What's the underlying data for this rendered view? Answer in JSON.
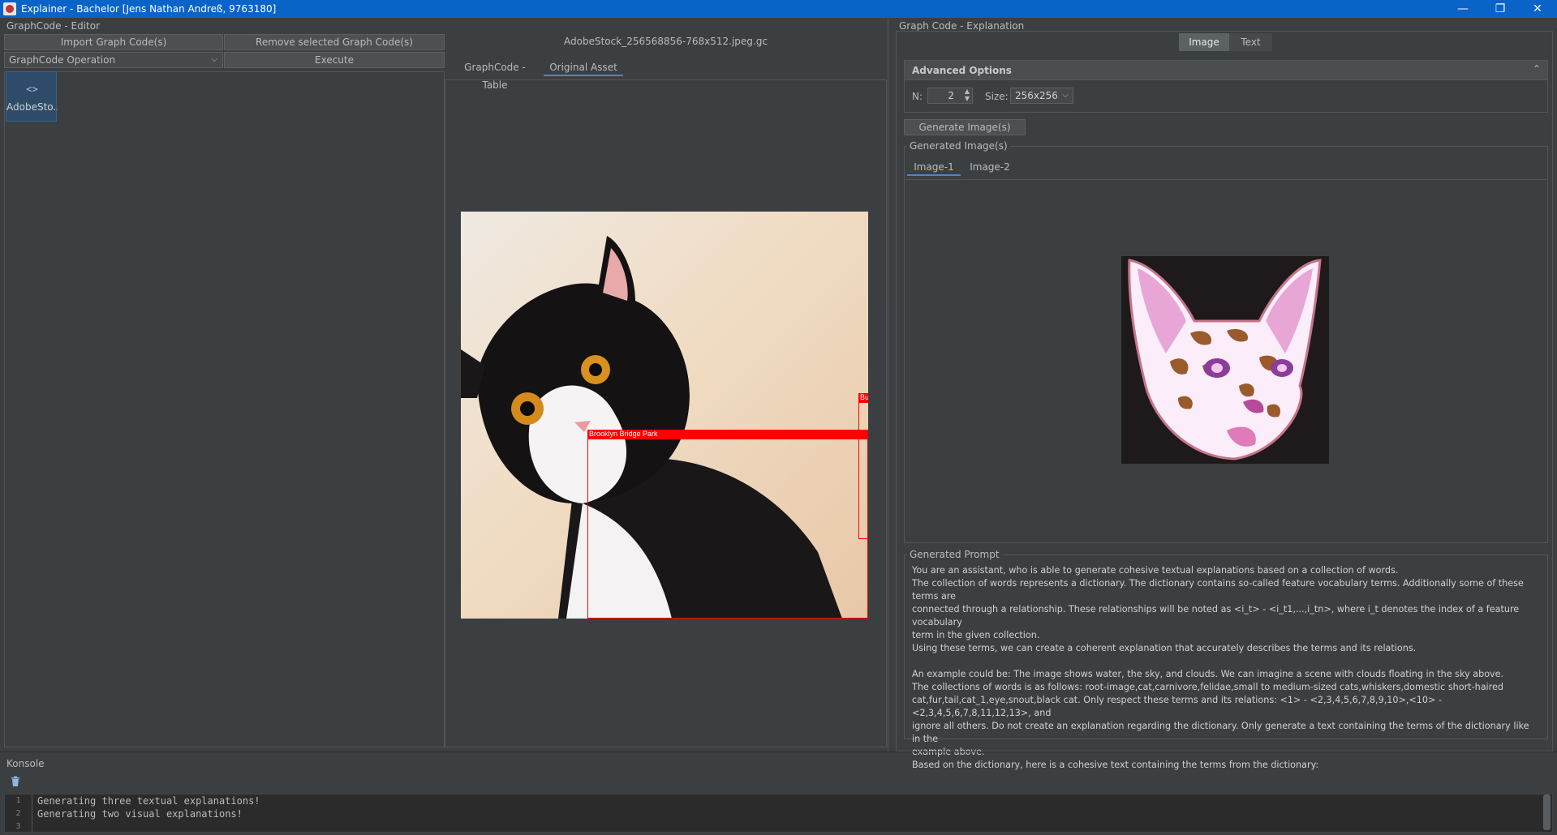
{
  "window": {
    "title": "Explainer - Bachelor [Jens Nathan Andreß, 9763180]",
    "minimize": "—",
    "restore": "❐",
    "close": "✕"
  },
  "editor": {
    "panel_title": "GraphCode - Editor",
    "import_label": "Import Graph Code(s)",
    "remove_label": "Remove selected Graph Code(s)",
    "operation_value": "GraphCode Operation",
    "execute_label": "Execute",
    "tile": {
      "icon": "code-icon",
      "label": "AdobeSto..."
    }
  },
  "viewer": {
    "file_name": "AdobeStock_256568856-768x512.jpeg.gc",
    "tabs": [
      "GraphCode - Table",
      "Original Asset"
    ],
    "active_tab": "Original Asset",
    "bbox_labels": [
      "Brooklyn Bridge Park",
      "Bu"
    ]
  },
  "explanation": {
    "panel_title": "Graph Code - Explanation",
    "mode_tabs": [
      "Image",
      "Text"
    ],
    "active_mode": "Image",
    "advanced_title": "Advanced Options",
    "n_label": "N:",
    "n_value": "2",
    "size_label": "Size:",
    "size_value": "256x256",
    "generate_label": "Generate Image(s)",
    "generated_images_title": "Generated Image(s)",
    "image_tabs": [
      "Image-1",
      "Image-2"
    ],
    "active_image_tab": "Image-1",
    "prompt_title": "Generated Prompt",
    "prompt_lines": [
      "You are an assistant, who is able to generate cohesive textual explanations based on a collection of words.",
      "The collection of words represents a dictionary. The dictionary contains so-called feature vocabulary terms. Additionally some of these terms are",
      "connected through a relationship. These relationships will be noted as <i_t> - <i_t1,...,i_tn>, where i_t denotes the index of a feature vocabulary",
      "term in the given collection.",
      "Using these terms, we can create a coherent explanation that accurately describes the terms and its relations.",
      "",
      "An example could be: The image shows water, the sky, and clouds. We can imagine a scene with clouds floating in the sky above.",
      "The collections of words is as follows: root-image,cat,carnivore,felidae,small to medium-sized cats,whiskers,domestic short-haired",
      "cat,fur,tail,cat_1,eye,snout,black cat. Only respect these terms and its relations: <1> - <2,3,4,5,6,7,8,9,10>,<10> - <2,3,4,5,6,7,8,11,12,13>, and",
      "ignore all others. Do not create an explanation regarding the dictionary. Only generate a text containing the terms of the dictionary like in the",
      "example above.",
      "Based on the dictionary, here is a cohesive text containing the terms from the dictionary:"
    ]
  },
  "console": {
    "title": "Konsole",
    "line_numbers": [
      "1",
      "2",
      "3"
    ],
    "lines": [
      "Generating three textual explanations!",
      "Generating two visual explanations!",
      ""
    ]
  },
  "colors": {
    "accent": "#4a88c7",
    "background": "#3c3f41",
    "bbox": "#ff0000",
    "titlebar": "#0a64c8"
  }
}
